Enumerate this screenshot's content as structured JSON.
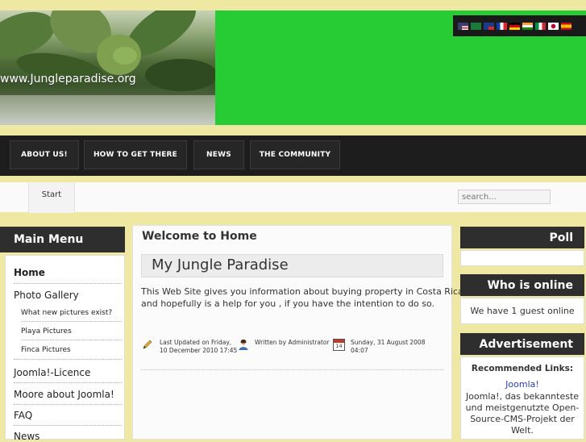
{
  "header": {
    "banner_url": "www.Jungleparadise.org",
    "flags": [
      "us-flag",
      "sa-flag",
      "tw-flag",
      "fr-flag",
      "de-flag",
      "in-flag",
      "it-flag",
      "jp-flag",
      "es-flag"
    ]
  },
  "nav": {
    "items": [
      {
        "label": "ABOUT US!"
      },
      {
        "label": "HOW TO GET THERE"
      },
      {
        "label": "NEWS"
      },
      {
        "label": "THE COMMUNITY"
      }
    ]
  },
  "breadcrumb": {
    "start": "Start"
  },
  "search": {
    "placeholder": "search..."
  },
  "left_menu": {
    "title": "Main Menu",
    "items": [
      {
        "label": "Home"
      },
      {
        "label": "Photo Gallery"
      },
      {
        "label": "What new pictures exist?"
      },
      {
        "label": "Playa Pictures"
      },
      {
        "label": "Finca Pictures"
      },
      {
        "label": "Joomla!-Licence"
      },
      {
        "label": "Moore about Joomla!"
      },
      {
        "label": "FAQ"
      },
      {
        "label": "News"
      }
    ]
  },
  "main": {
    "page_title": "Welcome to Home",
    "article_title": "My Jungle Paradise",
    "body_line1": "This Web Site gives you information about buying property in Costa Rica",
    "body_line2": "and hopefully is a help for you , if you have the intention to do so.",
    "meta": {
      "updated_line1": "Last Updated on Friday,",
      "updated_line2": "10 December 2010 17:45",
      "written_by": "Written by Administrator",
      "date_line1": "Sunday, 31 August 2008",
      "date_line2": "04:07",
      "calendar_day": "14"
    }
  },
  "right": {
    "poll_title": "Poll",
    "who_title": "Who is online",
    "who_text": "We have 1 guest online",
    "ad_title": "Advertisement",
    "recommended": "Recommended Links:",
    "link": "Joomla!",
    "desc1": "Joomla!, das bekannteste",
    "desc2": "und meistgenutzte Open-",
    "desc3": "Source-CMS-Projekt der",
    "desc4": "Welt."
  }
}
